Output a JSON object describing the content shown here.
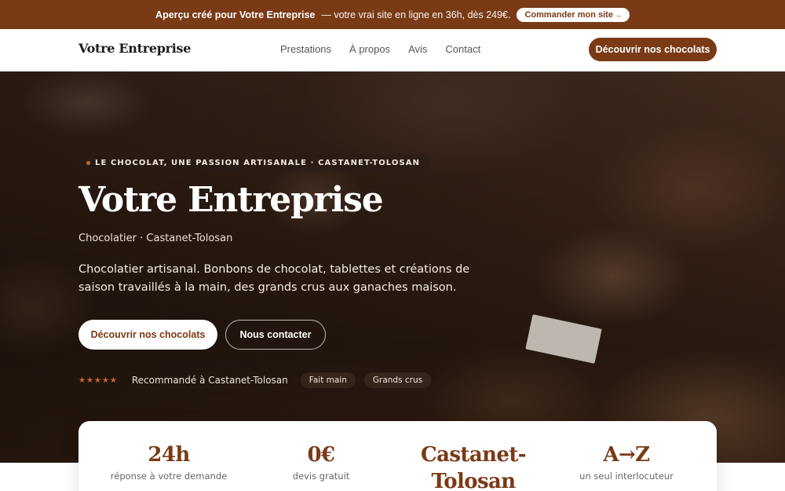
{
  "promo": {
    "lead": "Aperçu créé pour Votre Entreprise",
    "text": "— votre vrai site en ligne en 36h, dès 249€.",
    "cta": "Commander mon site",
    "cta_arrow": "→"
  },
  "nav": {
    "brand": "Votre Entreprise",
    "links": [
      "Prestations",
      "À propos",
      "Avis",
      "Contact"
    ],
    "cta": "Découvrir nos chocolats"
  },
  "hero": {
    "eyebrow": "LE CHOCOLAT, UNE PASSION ARTISANALE · CASTANET-TOLOSAN",
    "title": "Votre Entreprise",
    "subtitle": "Chocolatier · Castanet-Tolosan",
    "description": "Chocolatier artisanal. Bonbons de chocolat, tablettes et créations de saison travaillés à la main, des grands crus aux ganaches maison.",
    "primary_cta": "Découvrir nos chocolats",
    "secondary_cta": "Nous contacter",
    "stars": "★★★★★",
    "rating_value": 5,
    "proof_text": "Recommandé à Castanet-Tolosan",
    "chips": [
      "Fait main",
      "Grands crus"
    ]
  },
  "stats": [
    {
      "value": "24h",
      "label": "réponse à votre demande"
    },
    {
      "value": "0€",
      "label": "devis gratuit"
    },
    {
      "value": "Castanet-Tolosan",
      "label": ""
    },
    {
      "value": "A→Z",
      "label": "un seul interlocuteur"
    }
  ],
  "colors": {
    "brand": "#7a3a16",
    "star": "#c8652b"
  }
}
